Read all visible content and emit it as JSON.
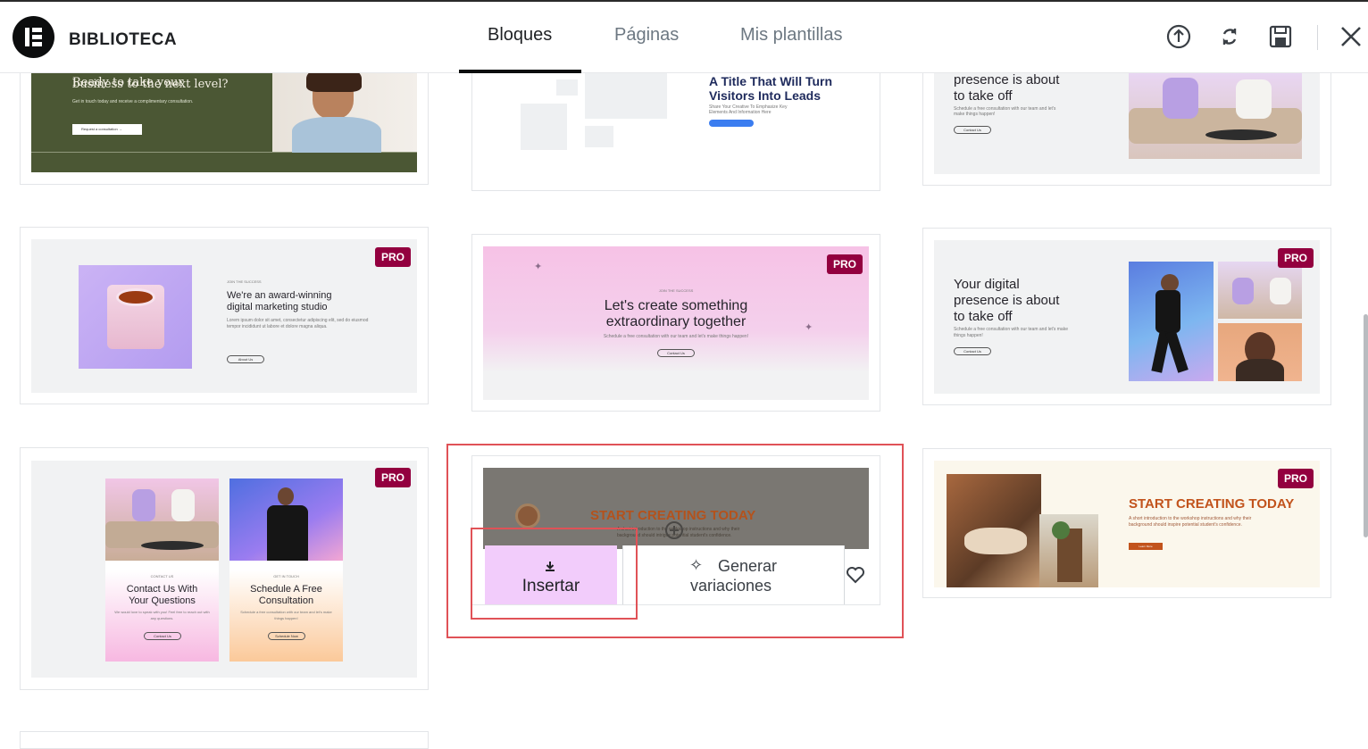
{
  "header": {
    "brand": "BIBLIOTECA",
    "tabs": [
      {
        "label": "Bloques",
        "active": true
      },
      {
        "label": "Páginas",
        "active": false
      },
      {
        "label": "Mis plantillas",
        "active": false
      }
    ],
    "icons": [
      "upload-icon",
      "sync-icon",
      "save-icon",
      "close-icon"
    ]
  },
  "badge": "PRO",
  "cards": {
    "c1": {
      "heading": "Ready to take your",
      "heading2": "business to the next level?",
      "text": "Get in touch today and receive a complimentary consultation.",
      "button": "Request a consultation →"
    },
    "c2": {
      "heading": "A Title That Will Turn",
      "heading2": "Visitors Into Leads",
      "text": "Share Your Creative To Emphasize Key",
      "text2": "Elements And Information Here"
    },
    "c3": {
      "heading": "presence is about",
      "heading2": "to take off",
      "text": "Schedule a free consultation with our team and let's",
      "text2": "make things happen!",
      "button": "Contact Us"
    },
    "c4": {
      "eyebrow": "JOIN THE SUCCESS",
      "heading": "We're an award-winning",
      "heading2": "digital marketing studio",
      "text": "Lorem ipsum dolor sit amet, consectetur adipiscing elit, sed do eiusmod tempor incididunt ut labore et dolore magna aliqua.",
      "button": "About Us"
    },
    "c5": {
      "eyebrow": "JOIN THE SUCCESS",
      "heading": "Let's create something",
      "heading2": "extraordinary together",
      "text": "Schedule a free consultation with our team and let's make things happen!",
      "button": "Contact Us"
    },
    "c6": {
      "heading": "Your digital",
      "heading2": "presence is about",
      "heading3": "to take off",
      "text": "Schedule a free consultation with our team and let's make things happen!",
      "button": "Contact Us"
    },
    "c7": {
      "left_eyebrow": "CONTACT US",
      "left_heading": "Contact Us With",
      "left_heading2": "Your Questions",
      "left_text": "We would love to speak with you! Feel free to reach out with any questions.",
      "left_button": "Contact Us",
      "right_eyebrow": "GET IN TOUCH",
      "right_heading": "Schedule A Free",
      "right_heading2": "Consultation",
      "right_text": "Schedule a free consultation with our team and let's make things happen!",
      "right_button": "Schedule Now"
    },
    "c8": {
      "heading": "START CREATING TODAY",
      "text": "A short introduction to the workshop instructions and why their",
      "text2": "background should intrigue potential student's confidence."
    },
    "c9": {
      "heading": "START CREATING TODAY",
      "text": "A short introduction to the workshop instructions and why their",
      "text2": "background should inspire potential student's confidence.",
      "button": "Learn More"
    }
  },
  "actions": {
    "insert_label": "Insertar",
    "generate_label": "Generar",
    "generate_label2": "variaciones"
  },
  "colors": {
    "accent_pro": "#93003f",
    "insert_bg": "#f2ccfb",
    "highlight": "#e05257",
    "orange": "#c2531c"
  }
}
